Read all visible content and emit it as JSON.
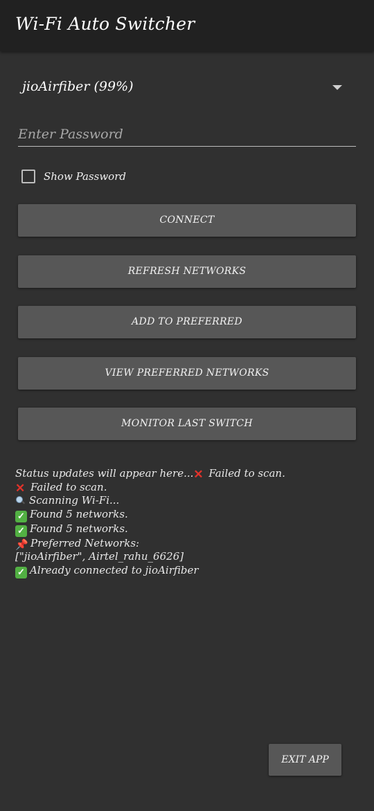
{
  "app_bar": {
    "title": "Wi-Fi Auto Switcher"
  },
  "network_spinner": {
    "selected": "jioAirfiber (99%)",
    "arrow_icon": "dropdown-arrow-icon"
  },
  "password": {
    "value": "",
    "placeholder": "Enter Password"
  },
  "show_password": {
    "label": "Show Password",
    "checked": false
  },
  "buttons": {
    "connect": "CONNECT",
    "refresh": "REFRESH NETWORKS",
    "add_preferred": "ADD TO PREFERRED",
    "view_preferred": "VIEW PREFERRED NETWORKS",
    "monitor": "MONITOR LAST SWITCH",
    "exit": "EXIT APP"
  },
  "status": {
    "lines": [
      {
        "prefix": "Status updates will appear here...",
        "icon": "cross-mark-icon",
        "text": "Failed to scan."
      },
      {
        "icon": "cross-mark-icon",
        "text": "Failed to scan."
      },
      {
        "icon": "magnifying-glass-icon",
        "text": "Scanning Wi-Fi..."
      },
      {
        "icon": "check-mark-icon",
        "text": "Found 5 networks."
      },
      {
        "icon": "check-mark-icon",
        "text": "Found 5 networks."
      },
      {
        "icon": "pushpin-icon",
        "text": "Preferred Networks:"
      },
      {
        "icon": "",
        "text": "[\"jioAirfiber\", Airtel_rahu_6626]"
      },
      {
        "icon": "check-mark-icon",
        "text": "Already connected to jioAirfiber"
      }
    ]
  },
  "colors": {
    "background": "#303030",
    "app_bar": "#212121",
    "button": "#575757",
    "cross": "#e0322a",
    "check": "#52b043"
  }
}
